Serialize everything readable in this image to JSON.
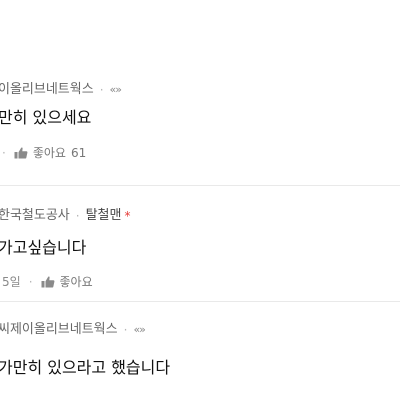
{
  "comments": [
    {
      "author": "이올리브네트웍스",
      "separator": "·",
      "tag": "«»",
      "body": "만히 있으세요",
      "meta_prefix": "·",
      "like_label": "좋아요",
      "like_count": "61"
    },
    {
      "author": "한국철도공사",
      "separator": "·",
      "nickname": "탈철맨",
      "star": "*",
      "body": "가고싶습니다",
      "time": "5일",
      "meta_prefix": "·",
      "like_label": "좋아요"
    },
    {
      "author": "씨제이올리브네트웍스",
      "separator": "·",
      "tag": "«»",
      "body": "가만히 있으라고 했습니다"
    }
  ],
  "icons": {
    "like": "thumbs-up-icon"
  },
  "colors": {
    "text_primary": "#111111",
    "text_secondary": "#666666",
    "meta": "#8a8a8a",
    "divider": "#e9e9e9",
    "star": "#e53935"
  }
}
